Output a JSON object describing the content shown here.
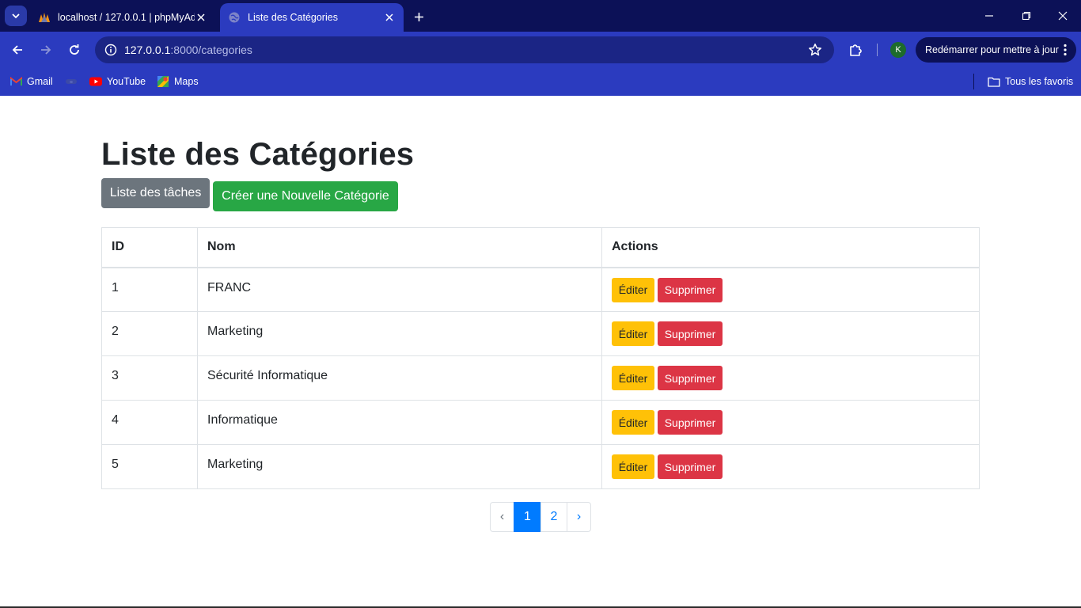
{
  "browser": {
    "tabs": [
      {
        "title": "localhost / 127.0.0.1 | phpMyAdmin",
        "icon": "phpmyadmin-icon",
        "active": false
      },
      {
        "title": "Liste des Catégories",
        "icon": "globe-icon",
        "active": true
      }
    ],
    "address_bar": {
      "host": "127.0.0.1",
      "path": ":8000/categories"
    },
    "profile_initial": "K",
    "update_button": "Redémarrer pour mettre à jour",
    "bookmarks": [
      {
        "label": "Gmail",
        "icon": "gmail-icon"
      },
      {
        "label": "",
        "icon": "generic-bookmark-icon"
      },
      {
        "label": "YouTube",
        "icon": "youtube-icon"
      },
      {
        "label": "Maps",
        "icon": "maps-icon"
      }
    ],
    "all_bookmarks": "Tous les favoris",
    "colors": {
      "frame": "#0c1157",
      "toolbar": "#2b3bbf",
      "omnibox": "#1b2585"
    }
  },
  "page": {
    "title": "Liste des Catégories",
    "buttons": {
      "tasks": "Liste des tâches",
      "create": "Créer une Nouvelle Catégorie"
    },
    "table": {
      "headers": [
        "ID",
        "Nom",
        "Actions"
      ],
      "rows": [
        {
          "id": "1",
          "nom": "FRANC"
        },
        {
          "id": "2",
          "nom": "Marketing"
        },
        {
          "id": "3",
          "nom": "Sécurité Informatique"
        },
        {
          "id": "4",
          "nom": "Informatique"
        },
        {
          "id": "5",
          "nom": "Marketing"
        }
      ],
      "edit_label": "Éditer",
      "delete_label": "Supprimer"
    },
    "pagination": {
      "prev": "‹",
      "pages": [
        "1",
        "2"
      ],
      "current": "1",
      "next": "›"
    },
    "colors": {
      "secondary": "#6c757d",
      "success": "#28a745",
      "warning": "#ffc107",
      "danger": "#dc3545",
      "primary": "#007bff"
    }
  }
}
